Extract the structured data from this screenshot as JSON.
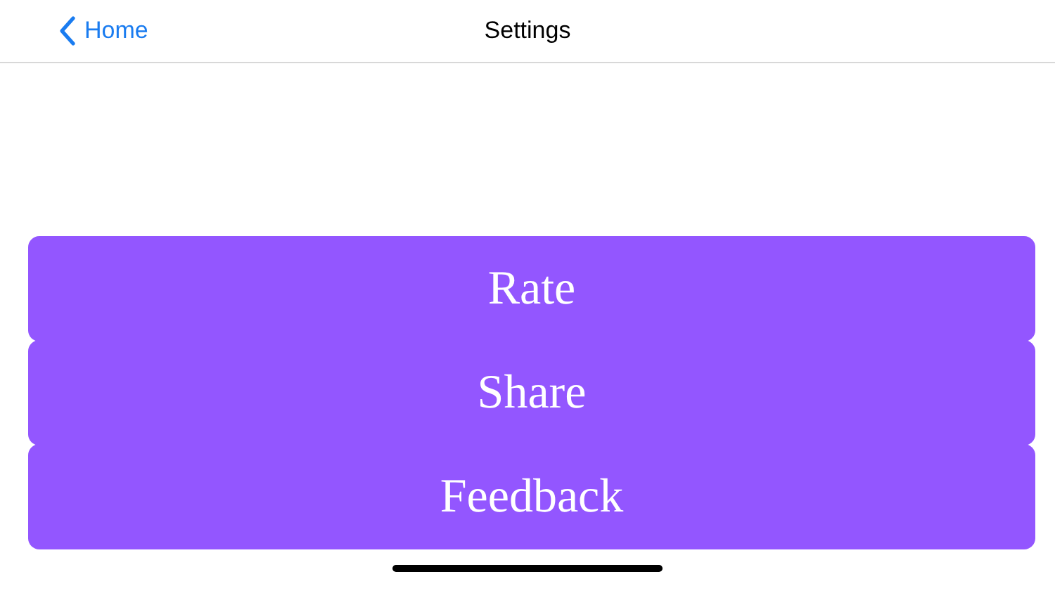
{
  "nav_bar": {
    "back_label": "Home",
    "title": "Settings"
  },
  "buttons": [
    {
      "label": "Rate"
    },
    {
      "label": "Share"
    },
    {
      "label": "Feedback"
    }
  ]
}
